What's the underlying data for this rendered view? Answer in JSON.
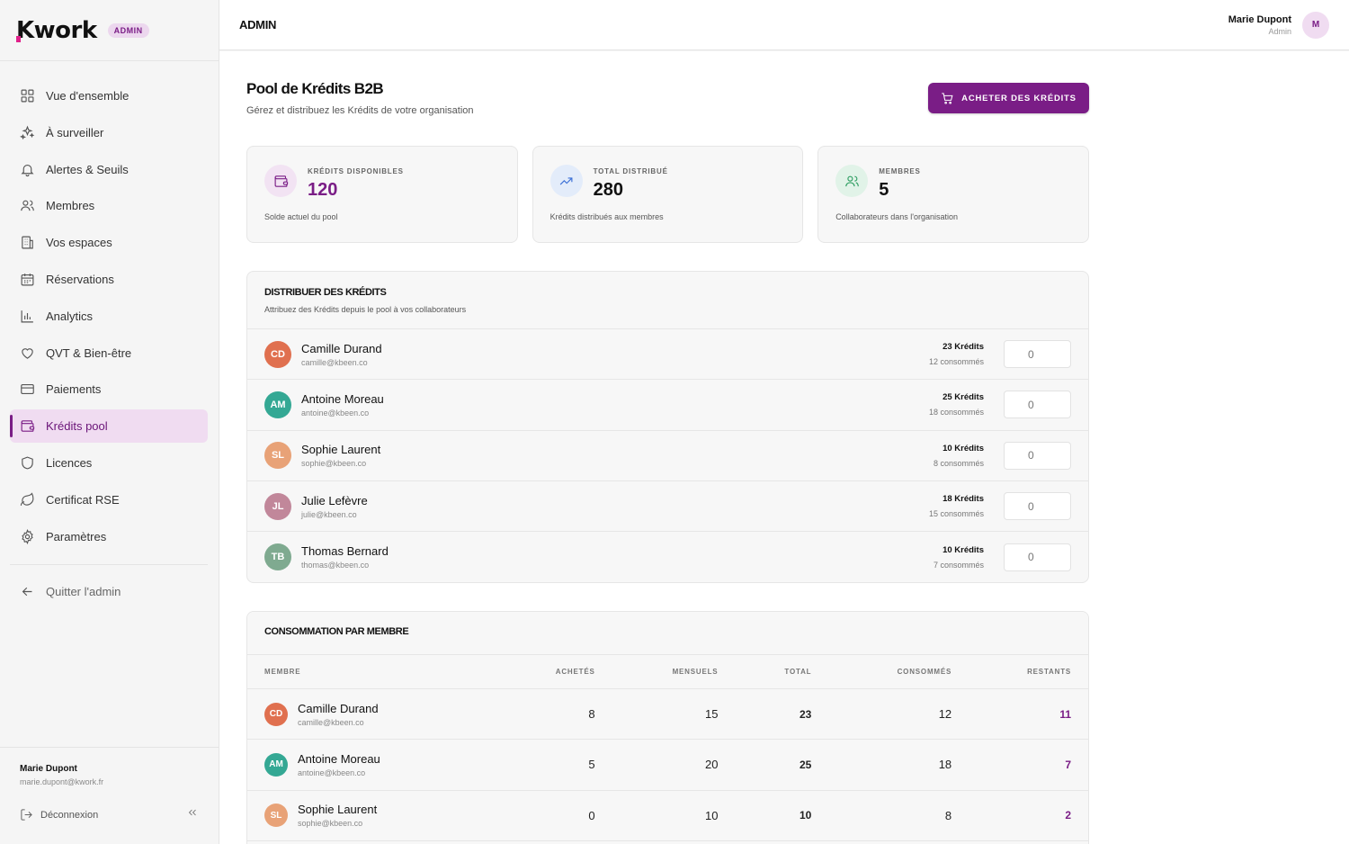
{
  "brand": {
    "logo_text": "Kwork",
    "badge": "ADMIN"
  },
  "sidebar": {
    "items": [
      {
        "label": "Vue d'ensemble",
        "icon": "grid-icon"
      },
      {
        "label": "À surveiller",
        "icon": "sparkles-icon"
      },
      {
        "label": "Alertes & Seuils",
        "icon": "bell-icon"
      },
      {
        "label": "Membres",
        "icon": "users-icon"
      },
      {
        "label": "Vos espaces",
        "icon": "building-icon"
      },
      {
        "label": "Réservations",
        "icon": "calendar-icon"
      },
      {
        "label": "Analytics",
        "icon": "bar-chart-icon"
      },
      {
        "label": "QVT & Bien-être",
        "icon": "heart-icon"
      },
      {
        "label": "Paiements",
        "icon": "credit-card-icon"
      },
      {
        "label": "Krédits pool",
        "icon": "wallet-icon",
        "active": true
      },
      {
        "label": "Licences",
        "icon": "shield-icon"
      },
      {
        "label": "Certificat RSE",
        "icon": "leaf-icon"
      },
      {
        "label": "Paramètres",
        "icon": "gear-icon"
      }
    ],
    "quit": "Quitter l'admin",
    "footer": {
      "name": "Marie Dupont",
      "email": "marie.dupont@kwork.fr",
      "logout": "Déconnexion"
    }
  },
  "topbar": {
    "title": "ADMIN",
    "user_name": "Marie Dupont",
    "user_role": "Admin",
    "avatar": "M"
  },
  "page": {
    "title": "Pool de Krédits B2B",
    "subtitle": "Gérez et distribuez les Krédits de votre organisation",
    "buy_button": "ACHETER DES KRÉDITS"
  },
  "stats": [
    {
      "label": "KRÉDITS DISPONIBLES",
      "value": "120",
      "desc": "Solde actuel du pool",
      "icon": "wallet-icon",
      "color": "#7a1d86"
    },
    {
      "label": "TOTAL DISTRIBUÉ",
      "value": "280",
      "desc": "Krédits distribués aux membres",
      "icon": "trending-up-icon",
      "color": "#3b6fd6"
    },
    {
      "label": "MEMBRES",
      "value": "5",
      "desc": "Collaborateurs dans l'organisation",
      "icon": "users-icon",
      "color": "#2e9e62"
    }
  ],
  "distribute": {
    "title": "DISTRIBUER DES KRÉDITS",
    "subtitle": "Attribuez des Krédits depuis le pool à vos collaborateurs",
    "members": [
      {
        "initials": "CD",
        "name": "Camille Durand",
        "email": "camille@kbeen.co",
        "credits": "23 Krédits",
        "used": "12 consommés",
        "value": "0",
        "color": "#e0704f"
      },
      {
        "initials": "AM",
        "name": "Antoine Moreau",
        "email": "antoine@kbeen.co",
        "credits": "25 Krédits",
        "used": "18 consommés",
        "value": "0",
        "color": "#34a894"
      },
      {
        "initials": "SL",
        "name": "Sophie Laurent",
        "email": "sophie@kbeen.co",
        "credits": "10 Krédits",
        "used": "8 consommés",
        "value": "0",
        "color": "#e8a277"
      },
      {
        "initials": "JL",
        "name": "Julie Lefèvre",
        "email": "julie@kbeen.co",
        "credits": "18 Krédits",
        "used": "15 consommés",
        "value": "0",
        "color": "#c1879a"
      },
      {
        "initials": "TB",
        "name": "Thomas Bernard",
        "email": "thomas@kbeen.co",
        "credits": "10 Krédits",
        "used": "7 consommés",
        "value": "0",
        "color": "#7faa90"
      }
    ]
  },
  "consumption": {
    "title": "CONSOMMATION PAR MEMBRE",
    "columns": [
      "MEMBRE",
      "ACHETÉS",
      "MENSUELS",
      "TOTAL",
      "CONSOMMÉS",
      "RESTANTS"
    ],
    "rows": [
      {
        "initials": "CD",
        "name": "Camille Durand",
        "email": "camille@kbeen.co",
        "achetes": "8",
        "mensuels": "15",
        "total": "23",
        "consommes": "12",
        "restants": "11",
        "color": "#e0704f"
      },
      {
        "initials": "AM",
        "name": "Antoine Moreau",
        "email": "antoine@kbeen.co",
        "achetes": "5",
        "mensuels": "20",
        "total": "25",
        "consommes": "18",
        "restants": "7",
        "color": "#34a894"
      },
      {
        "initials": "SL",
        "name": "Sophie Laurent",
        "email": "sophie@kbeen.co",
        "achetes": "0",
        "mensuels": "10",
        "total": "10",
        "consommes": "8",
        "restants": "2",
        "color": "#e8a277"
      }
    ]
  }
}
